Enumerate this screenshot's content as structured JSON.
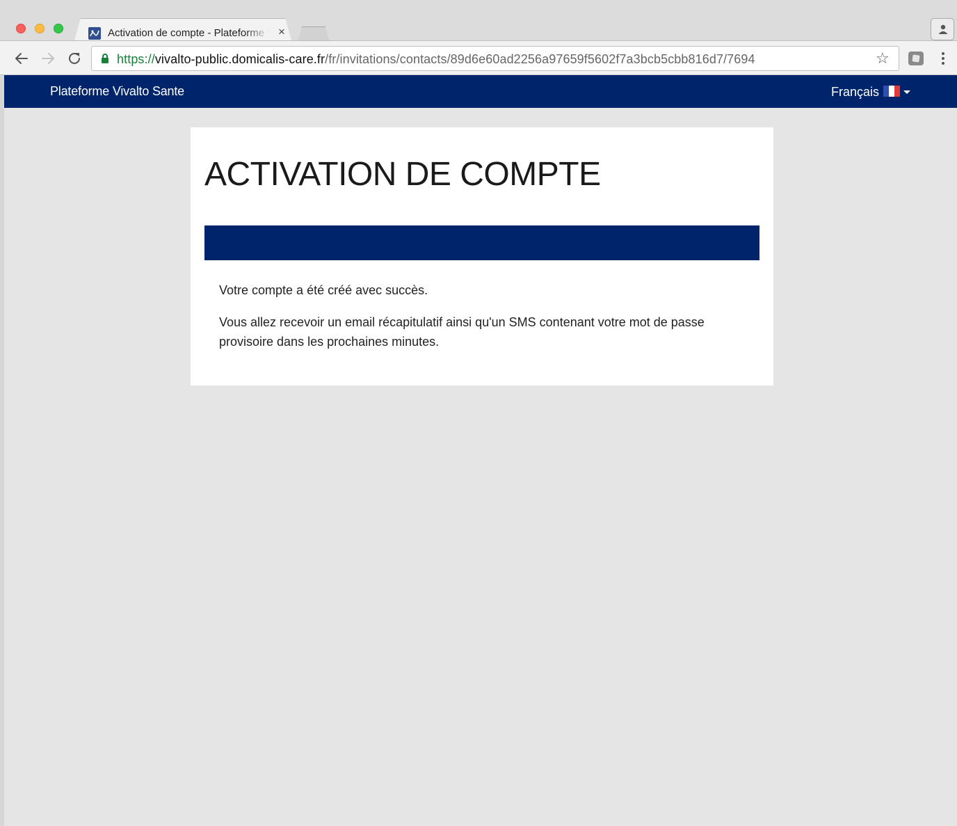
{
  "browser": {
    "tab_title": "Activation de compte - Plateforme Vivalto Sante",
    "tab_close": "×",
    "url": {
      "scheme": "https://",
      "host": "vivalto-public.domicalis-care.fr",
      "path": "/fr/invitations/contacts/89d6e60ad2256a97659f5602f7a3bcb5cbb816d7/7694"
    },
    "bookmark_glyph": "☆"
  },
  "navbar": {
    "brand": "Plateforme Vivalto Sante",
    "language": "Français",
    "background": "#00246b"
  },
  "card": {
    "title": "ACTIVATION DE COMPTE",
    "messages": [
      "Votre compte a été créé avec succès.",
      "Vous allez recevoir un email récapitulatif ainsi qu'un SMS contenant votre mot de passe provisoire dans les prochaines minutes."
    ]
  },
  "icons": {
    "favicon": "vivalto-favicon-icon",
    "lock": "lock-icon",
    "flag": "french-flag-icon"
  }
}
